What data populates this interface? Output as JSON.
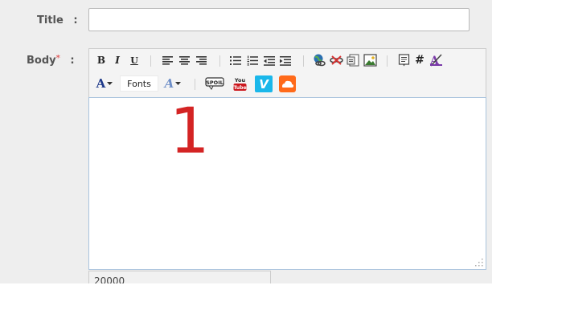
{
  "form": {
    "title_label": "Title",
    "body_label": "Body",
    "required_mark": "*",
    "colon": ":",
    "title_value": ""
  },
  "toolbar": {
    "bold": "B",
    "italic": "I",
    "underline": "U",
    "font_color_glyph": "A",
    "fonts_label": "Fonts",
    "highlight_glyph": "A",
    "hash": "#",
    "icons": [
      "align-left-icon",
      "align-center-icon",
      "align-right-icon",
      "bullet-list-icon",
      "numbered-list-icon",
      "outdent-icon",
      "indent-icon",
      "insert-link-icon",
      "remove-link-icon",
      "insert-file-icon",
      "insert-image-icon",
      "quote-icon",
      "hash-icon",
      "remove-format-icon",
      "spoiler-icon",
      "youtube-icon",
      "vimeo-icon",
      "soundcloud-icon"
    ],
    "spoiler_text": "SPOIL",
    "youtube_top": "You",
    "youtube_bottom": "Tube",
    "vimeo_letter": "V"
  },
  "editor": {
    "content": "1"
  },
  "counter": {
    "value": "20000"
  },
  "colors": {
    "panel_bg": "#eeeeee",
    "required": "#e06060",
    "content_red": "#d42424",
    "vimeo_blue": "#1ab7ea",
    "youtube_red": "#cc181e",
    "soundcloud_orange": "#ff6a1a"
  }
}
